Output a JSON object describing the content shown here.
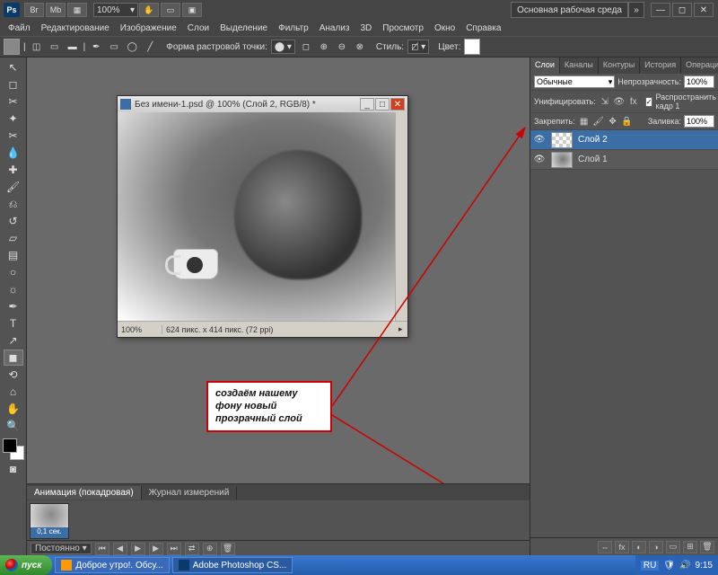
{
  "titlebar": {
    "app": "Ps",
    "zoom": "100%",
    "workspace": "Основная рабочая среда",
    "chevrons": "»"
  },
  "menu": {
    "items": [
      "Файл",
      "Редактирование",
      "Изображение",
      "Слои",
      "Выделение",
      "Фильтр",
      "Анализ",
      "3D",
      "Просмотр",
      "Окно",
      "Справка"
    ]
  },
  "optbar": {
    "shape_label": "Форма растровой точки:",
    "style_label": "Стиль:",
    "color_label": "Цвет:"
  },
  "doc": {
    "title": "Без имени-1.psd @ 100% (Слой 2, RGB/8) *",
    "zoom": "100%",
    "info": "624 пикс. x 414 пикс. (72 ppi)"
  },
  "annotation": {
    "text": "создаём нашему фону  новый прозрачный слой"
  },
  "animation": {
    "tab1": "Анимация (покадровая)",
    "tab2": "Журнал измерений",
    "frame_duration": "0,1 сек.",
    "loop": "Постоянно"
  },
  "layers_panel": {
    "tabs": [
      "Слои",
      "Каналы",
      "Контуры",
      "История",
      "Операции"
    ],
    "blend_mode": "Обычные",
    "opacity_label": "Непрозрачность:",
    "opacity": "100%",
    "unify_label": "Унифицировать:",
    "propagate": "Распространить кадр 1",
    "lock_label": "Закрепить:",
    "fill_label": "Заливка:",
    "fill": "100%",
    "layers": [
      {
        "name": "Слой 2",
        "selected": true,
        "thumb": "checker"
      },
      {
        "name": "Слой 1",
        "selected": false,
        "thumb": "img"
      }
    ]
  },
  "taskbar": {
    "start": "пуск",
    "items": [
      "Доброе утро!. Обсу...",
      "Adobe Photoshop CS..."
    ],
    "lang": "RU",
    "time": "9:15"
  }
}
